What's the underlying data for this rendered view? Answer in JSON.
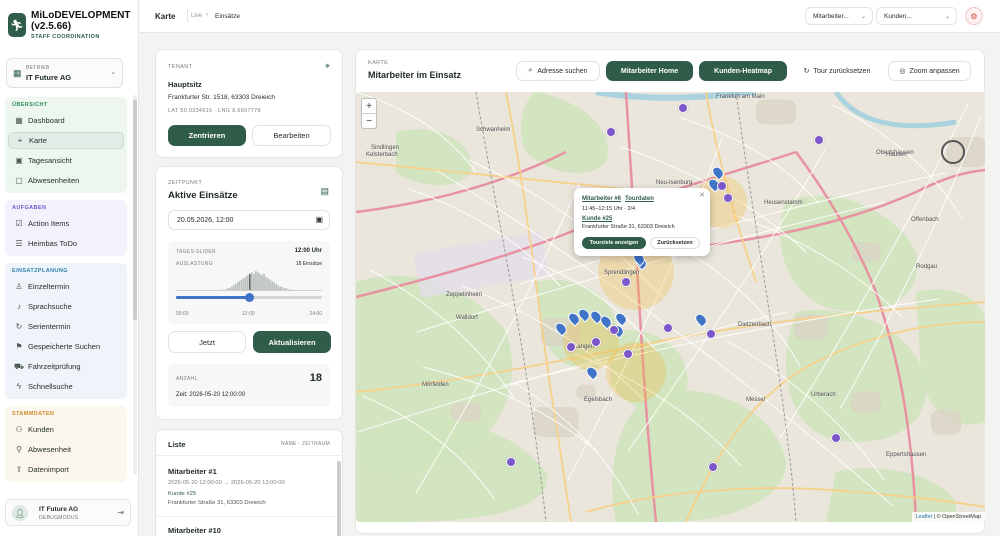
{
  "brand": {
    "name": "MiLoDEVELOPMENT (v2.5.66)",
    "subtitle": "STAFF COORDINATION"
  },
  "company": {
    "label": "BETRIEB",
    "value": "IT Future AG"
  },
  "nav": [
    {
      "title": "ÜBERSICHT",
      "color": "#2f8f5b",
      "items": [
        {
          "label": "Dashboard",
          "icon": "grid-icon"
        },
        {
          "label": "Karte",
          "icon": "map-pin-icon",
          "active": true
        },
        {
          "label": "Tagesansicht",
          "icon": "calendar-icon"
        },
        {
          "label": "Abwesenheiten",
          "icon": "calendar-x-icon"
        }
      ]
    },
    {
      "title": "AUFGABEN",
      "color": "#6d5bd0",
      "items": [
        {
          "label": "Action Items",
          "icon": "checklist-icon"
        },
        {
          "label": "Heimbas ToDo",
          "icon": "list-icon"
        }
      ]
    },
    {
      "title": "EINSATZPLANUNG",
      "color": "#2f7fb0",
      "items": [
        {
          "label": "Einzeltermin",
          "icon": "person-icon"
        },
        {
          "label": "Sprachsuche",
          "icon": "mic-icon"
        },
        {
          "label": "Serientermin",
          "icon": "repeat-icon"
        },
        {
          "label": "Gespeicherte Suchen",
          "icon": "bookmark-icon"
        },
        {
          "label": "Fahrzeitprüfung",
          "icon": "car-icon"
        },
        {
          "label": "Schnellsuche",
          "icon": "bolt-icon"
        }
      ]
    },
    {
      "title": "STAMMDATEN",
      "color": "#d08a2a",
      "items": [
        {
          "label": "Kunden",
          "icon": "users-icon"
        },
        {
          "label": "Abwesenheit",
          "icon": "run-icon"
        },
        {
          "label": "Datenimport",
          "icon": "upload-icon"
        }
      ]
    }
  ],
  "user": {
    "name": "IT Future AG",
    "role": "DEBUGMODUS"
  },
  "topbar": {
    "title": "Karte",
    "live": "Live",
    "crumb": "Einsätze",
    "employee_select": "Mitarbeiter...",
    "customer_select": "Kunden..."
  },
  "tenant": {
    "label": "TENANT",
    "name": "Hauptsitz",
    "address": "Frankfurter Str. 1518, 63303 Dreieich",
    "coords": "LAT 50.0334916 · LNG 8.6667778",
    "center_btn": "Zentrieren",
    "edit_btn": "Bearbeiten"
  },
  "time": {
    "label": "ZEITPUNKT",
    "title": "Aktive Einsätze",
    "datetime": "20.05.2026, 12:00",
    "slider_label": "TAGES-SLIDER",
    "slider_time": "12:00 Uhr",
    "load_label": "AUSLASTUNG",
    "load_value": "18 Einsätze",
    "ticks": [
      "00:00",
      "12:00",
      "24:00"
    ],
    "slider_value": 0.5,
    "histogram": [
      0,
      0,
      0,
      0,
      0,
      0,
      0,
      0,
      0,
      0,
      0,
      0,
      0,
      0,
      0,
      0,
      0,
      0,
      0,
      0,
      0,
      0,
      0,
      1,
      1,
      2,
      2,
      3,
      4,
      5,
      6,
      7,
      8,
      9,
      10,
      11,
      12,
      13,
      12,
      14,
      13,
      12,
      11,
      12,
      10,
      9,
      8,
      7,
      6,
      5,
      4,
      3,
      3,
      2,
      2,
      1,
      1,
      1,
      0,
      0,
      0,
      0,
      0,
      0,
      0,
      0,
      0,
      0,
      0,
      0,
      0,
      0
    ],
    "now_btn": "Jetzt",
    "refresh_btn": "Aktualisieren",
    "count_label": "ANZAHL",
    "count": "18",
    "stamp": "Zeit: 2026-05-20 12:00:00"
  },
  "list": {
    "title": "Liste",
    "sort": "NAME · ZEITRAUM",
    "items": [
      {
        "name": "Mitarbeiter #1",
        "time": "2026-05-20 12:00:00 → 2026-05-20 13:00:00",
        "customer": "Kunde #25",
        "address": "Frankfurter Straße 31, 63303 Dreieich"
      },
      {
        "name": "Mitarbeiter #10",
        "time": "",
        "customer": "",
        "address": ""
      }
    ]
  },
  "map": {
    "label": "KARTE",
    "title": "Mitarbeiter im Einsatz",
    "buttons": {
      "search": "Adresse suchen",
      "home": "Mitarbeiter Home",
      "heatmap": "Kunden-Heatmap",
      "reset": "Tour zurücksetzen",
      "fit": "Zoom anpassen"
    },
    "places": [
      "Frankfurt am Main",
      "Offenbach",
      "Sprendlingen",
      "Langen",
      "Egelsbach",
      "Dietzenbach",
      "Heusenstamm",
      "Rodgau",
      "Mörfelden",
      "Walldorf",
      "Kelsterbach",
      "Obertshausen",
      "Hausen",
      "Dreieich",
      "Neu-Isenburg",
      "Schwanheim",
      "Sindlingen",
      "Zeppelinheim",
      "Messel",
      "Urberach",
      "Eppertshausen"
    ],
    "popup": {
      "employee": "Mitarbeiter #6",
      "tour": "Tourdaten",
      "time": "11:45–12:15 Uhr · 2/4",
      "customer": "Kunde #25",
      "address": "Frankfurter Straße 31, 63303 Dreieich",
      "show_btn": "Tourziele anzeigen",
      "reset_btn": "Zurücksetzen"
    },
    "attribution_leaflet": "Leaflet",
    "attribution_rest": "| © OpenStreetMap"
  },
  "colors": {
    "primary": "#2f5d4a",
    "employee_pin": "#3f74c7",
    "customer_pin": "#7b57c9",
    "heat": "#f2b637"
  }
}
